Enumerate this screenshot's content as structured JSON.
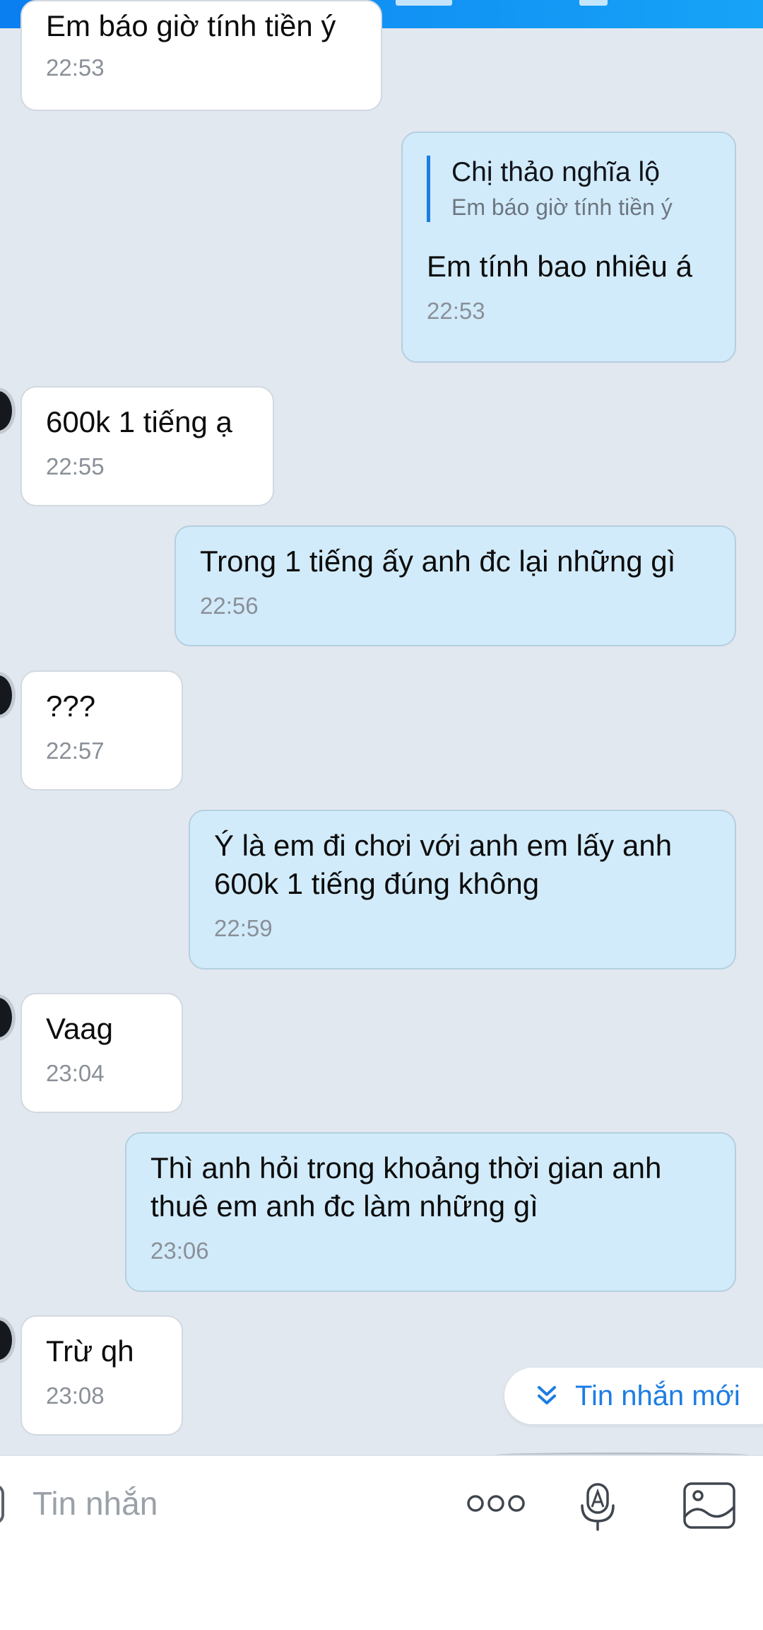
{
  "chat": {
    "messages": [
      {
        "dir": "in",
        "text": "Em báo giờ tính tiền ý",
        "time": "22:53"
      },
      {
        "dir": "out",
        "quote": {
          "name": "Chị thảo nghĩa lộ",
          "text": "Em báo giờ tính tiền ý"
        },
        "text": "Em tính bao nhiêu á",
        "time": "22:53"
      },
      {
        "dir": "in",
        "text": "600k 1 tiếng ạ",
        "time": "22:55"
      },
      {
        "dir": "out",
        "text": "Trong 1 tiếng ấy anh đc lại những gì",
        "time": "22:56"
      },
      {
        "dir": "in",
        "text": "???",
        "time": "22:57"
      },
      {
        "dir": "out",
        "text": "Ý là em đi chơi với anh em lấy anh\n600k 1 tiếng đúng không",
        "time": "22:59"
      },
      {
        "dir": "in",
        "text": "Vaag",
        "time": "23:04"
      },
      {
        "dir": "out",
        "text": "Thì anh hỏi trong khoảng thời gian anh\nthuê em anh đc làm những gì",
        "time": "23:06"
      },
      {
        "dir": "in",
        "text": "Trừ qh",
        "time": "23:08"
      }
    ]
  },
  "new_messages_button": {
    "label": "Tin nhắn mới",
    "icon": "double-chevron-down-icon"
  },
  "composer": {
    "placeholder": "Tin nhắn",
    "icons": [
      "more-options-icon",
      "voice-to-text-icon",
      "image-gallery-icon"
    ]
  },
  "colors": {
    "background": "#e2e8ef",
    "incoming_bubble": "#ffffff",
    "outgoing_bubble": "#d2ebfa",
    "accent": "#1c7de3"
  }
}
